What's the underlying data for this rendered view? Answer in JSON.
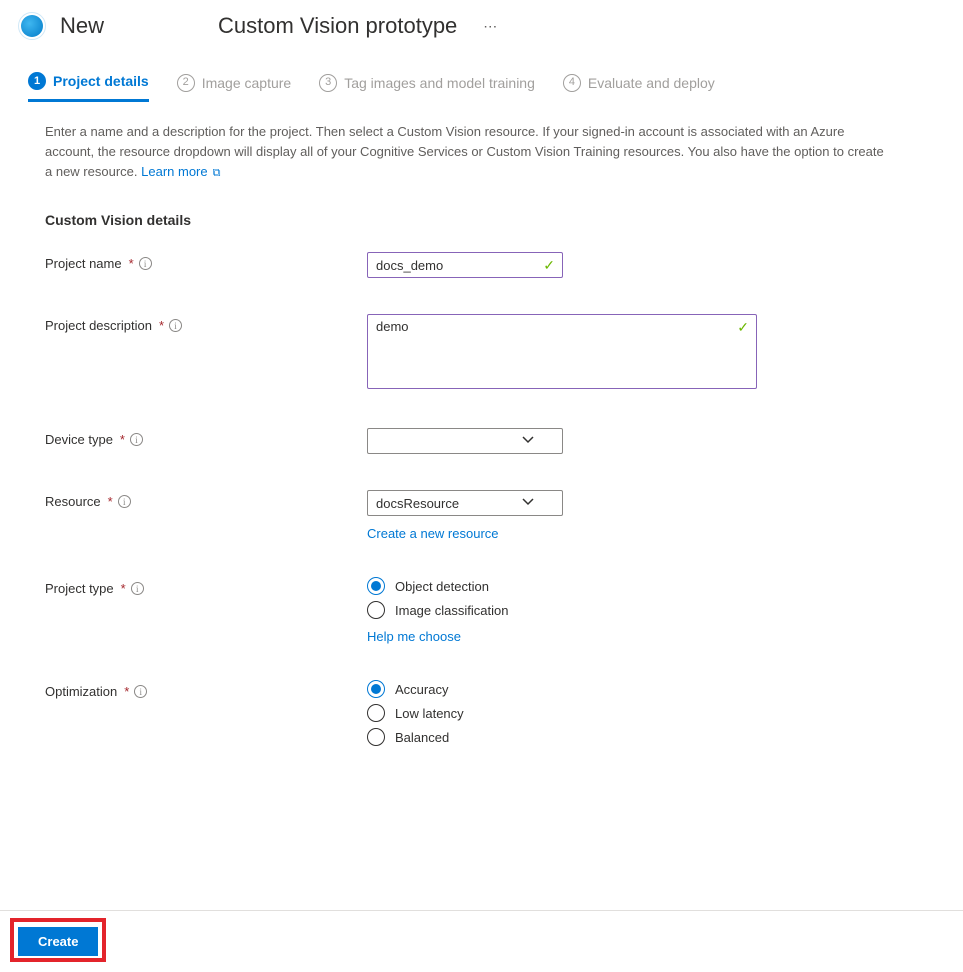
{
  "header": {
    "new_label": "New",
    "title": "Custom Vision prototype"
  },
  "steps": [
    {
      "num": "1",
      "label": "Project details",
      "active": true
    },
    {
      "num": "2",
      "label": "Image capture",
      "active": false
    },
    {
      "num": "3",
      "label": "Tag images and model training",
      "active": false
    },
    {
      "num": "4",
      "label": "Evaluate and deploy",
      "active": false
    }
  ],
  "intro": {
    "text": "Enter a name and a description for the project. Then select a Custom Vision resource. If your signed-in account is associated with an Azure account, the resource dropdown will display all of your Cognitive Services or Custom Vision Training resources. You also have the option to create a new resource.",
    "link_label": "Learn more"
  },
  "section_heading": "Custom Vision details",
  "fields": {
    "project_name": {
      "label": "Project name",
      "value": "docs_demo"
    },
    "project_description": {
      "label": "Project description",
      "value": "demo"
    },
    "device_type": {
      "label": "Device type",
      "value": ""
    },
    "resource": {
      "label": "Resource",
      "value": "docsResource",
      "create_link": "Create a new resource"
    },
    "project_type": {
      "label": "Project type",
      "options": [
        "Object detection",
        "Image classification"
      ],
      "selected": "Object detection",
      "help_link": "Help me choose"
    },
    "optimization": {
      "label": "Optimization",
      "options": [
        "Accuracy",
        "Low latency",
        "Balanced"
      ],
      "selected": "Accuracy"
    }
  },
  "footer": {
    "create_label": "Create"
  }
}
